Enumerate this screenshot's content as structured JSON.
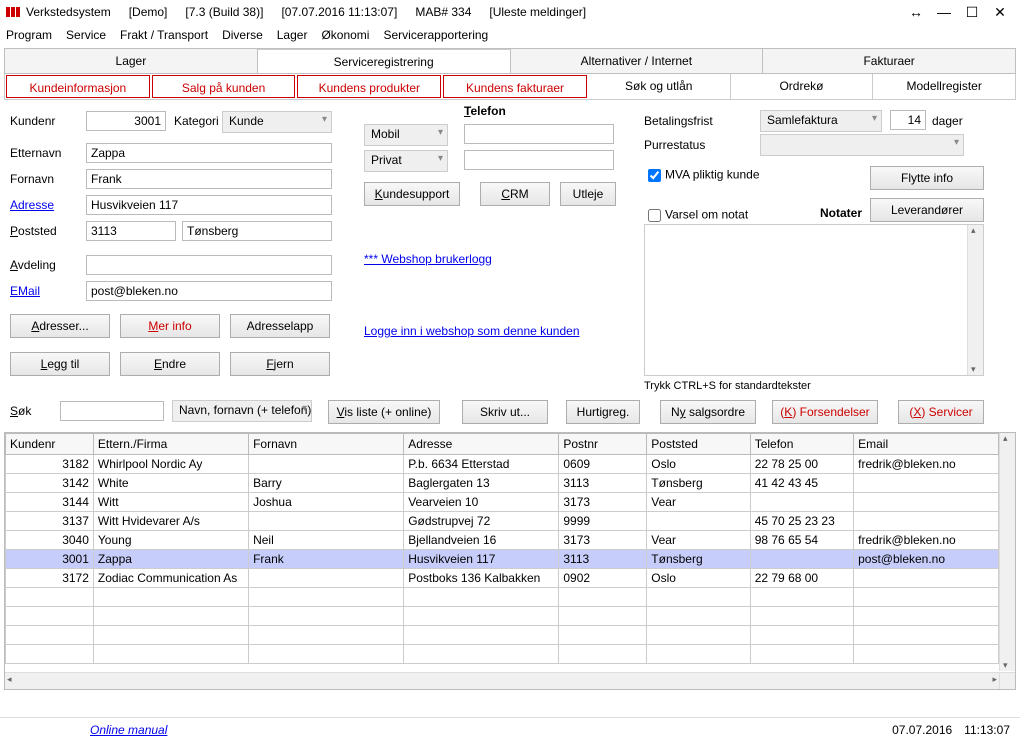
{
  "title": {
    "app": "Verkstedsystem",
    "demo": "[Demo]",
    "build": "[7.3 (Build 38)]",
    "date": "[07.07.2016  11:13:07]",
    "mab": "MAB# 334",
    "msgs": "[Uleste meldinger]"
  },
  "menu": [
    "Program",
    "Service",
    "Frakt / Transport",
    "Diverse",
    "Lager",
    "Økonomi",
    "Servicerapportering"
  ],
  "tabs1": [
    "Lager",
    "Serviceregistrering",
    "Alternativer / Internet",
    "Fakturaer"
  ],
  "tabs1_active": 1,
  "tabs2": [
    "Kundeinformasjon",
    "Salg på kunden",
    "Kundens produkter",
    "Kundens fakturaer",
    "Søk og utlån",
    "Ordrekø",
    "Modellregister"
  ],
  "labels": {
    "kundenr": "Kundenr",
    "kategori": "Kategori",
    "etternavn": "Etternavn",
    "fornavn": "Fornavn",
    "adresse": "Adresse",
    "poststed": "Poststed",
    "avdeling": "Avdeling",
    "email": "EMail",
    "telefon": "Telefon",
    "betalingsfrist": "Betalingsfrist",
    "dager": "dager",
    "purrestatus": "Purrestatus",
    "mva": "MVA pliktig kunde",
    "varsel": "Varsel om notat",
    "notater": "Notater",
    "standardtekster": "Trykk CTRL+S for standardtekster",
    "sok": "Søk"
  },
  "values": {
    "kundenr": "3001",
    "kategori": "Kunde",
    "etternavn": "Zappa",
    "fornavn": "Frank",
    "adresse": "Husvikveien 117",
    "postnr": "3113",
    "poststed": "Tønsberg",
    "avdeling": "",
    "email": "post@bleken.no",
    "mobil": "Mobil",
    "privat": "Privat",
    "betalingsfrist": "Samlefaktura",
    "betalingsfrist_dager": "14",
    "sok_opt": "Navn, fornavn (+ telefon)"
  },
  "buttons": {
    "adresser": "Adresser...",
    "mer_info": "Mer info",
    "adresselapp": "Adresselapp",
    "legg_til": "Legg til",
    "endre": "Endre",
    "fjern": "Fjern",
    "kundesupport": "Kundesupport",
    "crm": "CRM",
    "utleje": "Utleje",
    "flytte_info": "Flytte info",
    "leverandorer": "Leverandører",
    "vis_liste": "Vis liste (+ online)",
    "skriv_ut": "Skriv ut...",
    "hurtigreg": "Hurtigreg.",
    "ny_salgsordre": "Ny salgsordre",
    "forsendelser": "(K) Forsendelser",
    "servicer": "(X) Servicer"
  },
  "links": {
    "webshop_log": "*** Webshop brukerlogg",
    "login_webshop": "Logge inn i webshop som denne kunden",
    "online_manual": "Online manual"
  },
  "grid": {
    "headers": [
      "Kundenr",
      "Ettern./Firma",
      "Fornavn",
      "Adresse",
      "Postnr",
      "Poststed",
      "Telefon",
      "Email"
    ],
    "rows": [
      {
        "kundenr": "3182",
        "ettern": "Whirlpool Nordic Ay",
        "fornavn": "",
        "adresse": "P.b. 6634 Etterstad",
        "postnr": "0609",
        "poststed": "Oslo",
        "telefon": "22 78 25 00",
        "email": "fredrik@bleken.no"
      },
      {
        "kundenr": "3142",
        "ettern": "White",
        "fornavn": "Barry",
        "adresse": "Baglergaten 13",
        "postnr": "3113",
        "poststed": "Tønsberg",
        "telefon": "41 42 43 45",
        "email": ""
      },
      {
        "kundenr": "3144",
        "ettern": "Witt",
        "fornavn": "Joshua",
        "adresse": "Vearveien 10",
        "postnr": "3173",
        "poststed": "Vear",
        "telefon": "",
        "email": ""
      },
      {
        "kundenr": "3137",
        "ettern": "Witt Hvidevarer A/s",
        "fornavn": "",
        "adresse": "Gødstrupvej 72",
        "postnr": "9999",
        "poststed": "",
        "telefon": "45 70 25 23 23",
        "email": ""
      },
      {
        "kundenr": "3040",
        "ettern": "Young",
        "fornavn": "Neil",
        "adresse": "Bjellandveien 16",
        "postnr": "3173",
        "poststed": "Vear",
        "telefon": "98 76 65 54",
        "email": "fredrik@bleken.no"
      },
      {
        "kundenr": "3001",
        "ettern": "Zappa",
        "fornavn": "Frank",
        "adresse": "Husvikveien 117",
        "postnr": "3113",
        "poststed": "Tønsberg",
        "telefon": "",
        "email": "post@bleken.no"
      },
      {
        "kundenr": "3172",
        "ettern": "Zodiac Communication As",
        "fornavn": "",
        "adresse": "Postboks 136  Kalbakken",
        "postnr": "0902",
        "poststed": "Oslo",
        "telefon": "22 79 68 00",
        "email": ""
      }
    ],
    "selected": 5
  },
  "status": {
    "date": "07.07.2016",
    "time": "11:13:07"
  }
}
